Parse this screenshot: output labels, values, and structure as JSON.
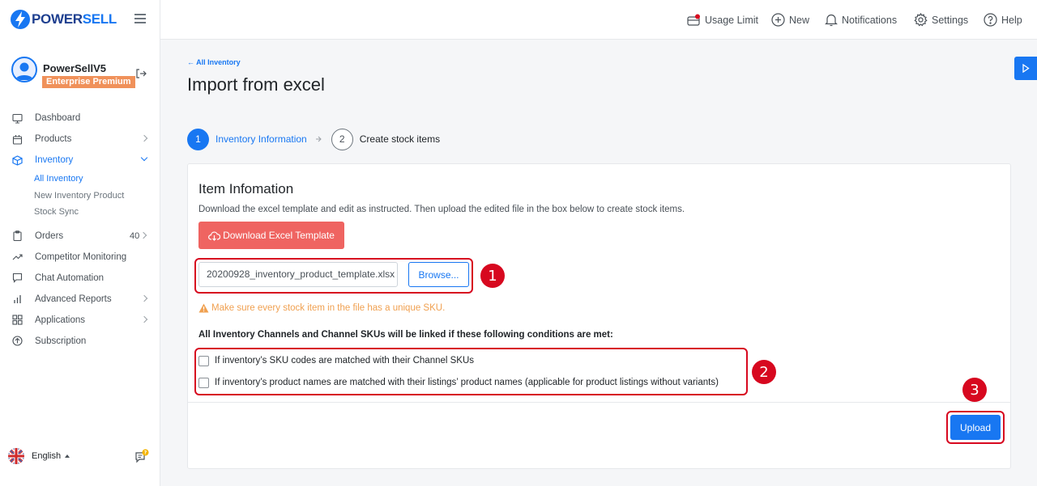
{
  "brand": {
    "logo_prefix": "POWER",
    "logo_suffix": "SELL",
    "primary_color": "#1877f2",
    "danger_color": "#ef6461",
    "highlight_color": "#d7081f"
  },
  "profile": {
    "name": "PowerSellV5",
    "plan": "Enterprise Premium"
  },
  "sidebar": {
    "items": [
      {
        "label": "Dashboard",
        "icon": "monitor-icon"
      },
      {
        "label": "Products",
        "icon": "box-icon"
      },
      {
        "label": "Inventory",
        "icon": "cube-icon"
      },
      {
        "label": "Orders",
        "icon": "clipboard-icon",
        "count": "40"
      },
      {
        "label": "Competitor Monitoring",
        "icon": "trend-icon"
      },
      {
        "label": "Chat Automation",
        "icon": "chat-icon"
      },
      {
        "label": "Advanced Reports",
        "icon": "bar-chart-icon"
      },
      {
        "label": "Applications",
        "icon": "grid-icon"
      },
      {
        "label": "Subscription",
        "icon": "arrow-up-circle-icon"
      }
    ],
    "inventory_sub": [
      {
        "label": "All Inventory"
      },
      {
        "label": "New Inventory Product"
      },
      {
        "label": "Stock Sync"
      }
    ],
    "language": "English"
  },
  "topbar": {
    "usage_limit": "Usage Limit",
    "new": "New",
    "notifications": "Notifications",
    "settings": "Settings",
    "help": "Help"
  },
  "page": {
    "back_link": "All Inventory",
    "back_arrow": "←",
    "title": "Import from excel"
  },
  "steps": [
    {
      "number": "1",
      "label": "Inventory Information",
      "state": "active"
    },
    {
      "number": "2",
      "label": "Create stock items",
      "state": "idle"
    }
  ],
  "card": {
    "title": "Item Infomation",
    "description": "Download the excel template and edit as instructed. Then upload the edited file in the box below to create stock items.",
    "download_button": "Download Excel Template",
    "file_name": "20200928_inventory_product_template.xlsx",
    "browse_button": "Browse...",
    "warning": "Make sure every stock item in the file has a unique SKU.",
    "conditions_title": "All Inventory Channels and Channel SKUs will be linked if these following conditions are met:",
    "conditions": [
      {
        "label": "If inventory’s SKU codes are matched with their Channel SKUs",
        "checked": false
      },
      {
        "label": "If inventory’s product names are matched with their listings’ product names (applicable for product listings without variants)",
        "checked": false
      }
    ],
    "upload_button": "Upload"
  },
  "annotations": {
    "badge_1": "1",
    "badge_2": "2",
    "badge_3": "3"
  }
}
